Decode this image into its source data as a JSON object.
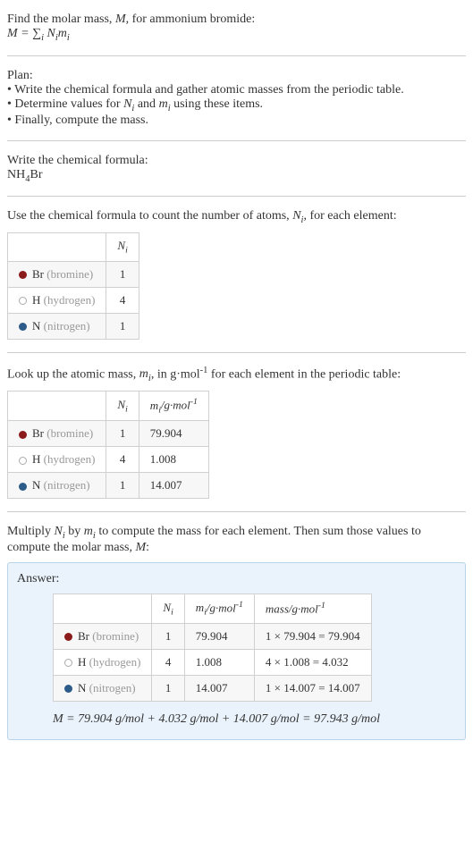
{
  "intro": {
    "line1": "Find the molar mass, M, for ammonium bromide:",
    "formula": "M = ∑",
    "formula_sub": "i",
    "formula_rest": " Nᵢmᵢ"
  },
  "plan": {
    "title": "Plan:",
    "bullet1": "• Write the chemical formula and gather atomic masses from the periodic table.",
    "bullet2": "• Determine values for Nᵢ and mᵢ using these items.",
    "bullet3": "• Finally, compute the mass."
  },
  "step1": {
    "title": "Write the chemical formula:",
    "formula_prefix": "NH",
    "formula_sub": "4",
    "formula_suffix": "Br"
  },
  "step2": {
    "title": "Use the chemical formula to count the number of atoms, Nᵢ, for each element:",
    "header_ni": "Nᵢ",
    "rows": [
      {
        "dot": "dot-br",
        "sym": "Br",
        "name": "(bromine)",
        "ni": "1"
      },
      {
        "dot": "dot-h",
        "sym": "H",
        "name": "(hydrogen)",
        "ni": "4"
      },
      {
        "dot": "dot-n",
        "sym": "N",
        "name": "(nitrogen)",
        "ni": "1"
      }
    ]
  },
  "step3": {
    "title": "Look up the atomic mass, mᵢ, in g·mol⁻¹ for each element in the periodic table:",
    "header_ni": "Nᵢ",
    "header_mi": "mᵢ/g·mol⁻¹",
    "rows": [
      {
        "dot": "dot-br",
        "sym": "Br",
        "name": "(bromine)",
        "ni": "1",
        "mi": "79.904"
      },
      {
        "dot": "dot-h",
        "sym": "H",
        "name": "(hydrogen)",
        "ni": "4",
        "mi": "1.008"
      },
      {
        "dot": "dot-n",
        "sym": "N",
        "name": "(nitrogen)",
        "ni": "1",
        "mi": "14.007"
      }
    ]
  },
  "step4": {
    "title": "Multiply Nᵢ by mᵢ to compute the mass for each element. Then sum those values to compute the molar mass, M:"
  },
  "answer": {
    "label": "Answer:",
    "header_ni": "Nᵢ",
    "header_mi": "mᵢ/g·mol⁻¹",
    "header_mass": "mass/g·mol⁻¹",
    "rows": [
      {
        "dot": "dot-br",
        "sym": "Br",
        "name": "(bromine)",
        "ni": "1",
        "mi": "79.904",
        "mass": "1 × 79.904 = 79.904"
      },
      {
        "dot": "dot-h",
        "sym": "H",
        "name": "(hydrogen)",
        "ni": "4",
        "mi": "1.008",
        "mass": "4 × 1.008 = 4.032"
      },
      {
        "dot": "dot-n",
        "sym": "N",
        "name": "(nitrogen)",
        "ni": "1",
        "mi": "14.007",
        "mass": "1 × 14.007 = 14.007"
      }
    ],
    "final": "M = 79.904 g/mol + 4.032 g/mol + 14.007 g/mol = 97.943 g/mol"
  },
  "chart_data": {
    "type": "table",
    "title": "Molar mass calculation for ammonium bromide NH4Br",
    "elements": [
      {
        "element": "Br",
        "name": "bromine",
        "N_i": 1,
        "m_i_g_per_mol": 79.904,
        "mass_g_per_mol": 79.904
      },
      {
        "element": "H",
        "name": "hydrogen",
        "N_i": 4,
        "m_i_g_per_mol": 1.008,
        "mass_g_per_mol": 4.032
      },
      {
        "element": "N",
        "name": "nitrogen",
        "N_i": 1,
        "m_i_g_per_mol": 14.007,
        "mass_g_per_mol": 14.007
      }
    ],
    "molar_mass_g_per_mol": 97.943
  }
}
